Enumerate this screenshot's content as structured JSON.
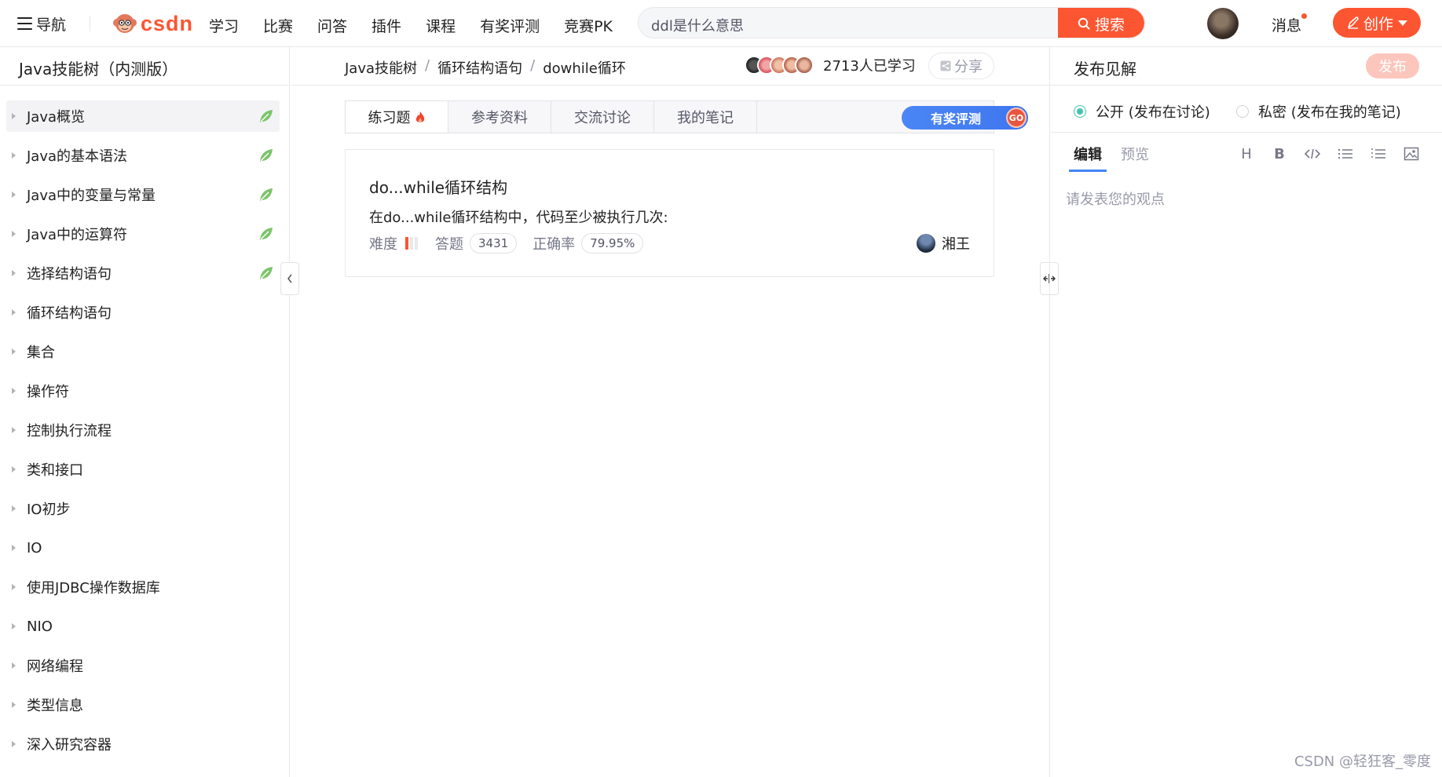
{
  "topbar": {
    "nav_label": "导航",
    "logo_text": "CSDN",
    "nav_links": [
      "学习",
      "比赛",
      "问答",
      "插件",
      "课程",
      "有奖评测",
      "竞赛PK"
    ],
    "search_value": "ddl是什么意思",
    "search_button": "搜索",
    "message_label": "消息",
    "create_label": "创作"
  },
  "sidebar": {
    "title": "Java技能树（内测版）",
    "items": [
      {
        "label": "Java概览",
        "done": true,
        "active": true
      },
      {
        "label": "Java的基本语法",
        "done": true
      },
      {
        "label": "Java中的变量与常量",
        "done": true
      },
      {
        "label": "Java中的运算符",
        "done": true
      },
      {
        "label": "选择结构语句",
        "done": true
      },
      {
        "label": "循环结构语句",
        "done": false
      },
      {
        "label": "集合",
        "done": false
      },
      {
        "label": "操作符",
        "done": false
      },
      {
        "label": "控制执行流程",
        "done": false
      },
      {
        "label": "类和接口",
        "done": false
      },
      {
        "label": "IO初步",
        "done": false
      },
      {
        "label": "IO",
        "done": false
      },
      {
        "label": "使用JDBC操作数据库",
        "done": false
      },
      {
        "label": "NIO",
        "done": false
      },
      {
        "label": "网络编程",
        "done": false
      },
      {
        "label": "类型信息",
        "done": false
      },
      {
        "label": "深入研究容器",
        "done": false
      }
    ]
  },
  "breadcrumb": {
    "items": [
      "Java技能树",
      "循环结构语句",
      "dowhile循环"
    ],
    "separator": "/"
  },
  "learners": {
    "count_text": "2713人已学习",
    "avatar_colors": [
      "#2b2b2b",
      "#d94a55",
      "#c9745a",
      "#b35a45",
      "#a05a48"
    ]
  },
  "share_label": "分享",
  "tabs": {
    "items": [
      "练习题",
      "参考资料",
      "交流讨论",
      "我的笔记"
    ],
    "active": 0,
    "reward_label": "有奖评测",
    "reward_go": "GO"
  },
  "exercise": {
    "title": "do...while循环结构",
    "question": "在do...while循环结构中，代码至少被执行几次:",
    "difficulty_label": "难度",
    "difficulty_level": 1,
    "difficulty_max": 3,
    "answers_label": "答题",
    "answers_count": "3431",
    "accuracy_label": "正确率",
    "accuracy_value": "79.95%",
    "author": "湘王"
  },
  "right_panel": {
    "title": "发布见解",
    "publish_label": "发布",
    "visibility": [
      {
        "label": "公开 (发布在讨论)",
        "selected": true
      },
      {
        "label": "私密 (发布在我的笔记)",
        "selected": false
      }
    ],
    "editor_tabs": [
      "编辑",
      "预览"
    ],
    "toolbar_icons": [
      "heading-icon",
      "bold-icon",
      "code-icon",
      "unordered-list-icon",
      "ordered-list-icon",
      "image-icon"
    ],
    "placeholder": "请发表您的观点"
  },
  "watermark": "CSDN @轻狂客_零度",
  "colors": {
    "brand": "#fc5531",
    "leaf_green": "#7cc46c",
    "radio_teal": "#45c2b0",
    "tab_underline": "#4285f4",
    "reward_blue": "#3e76ee"
  }
}
